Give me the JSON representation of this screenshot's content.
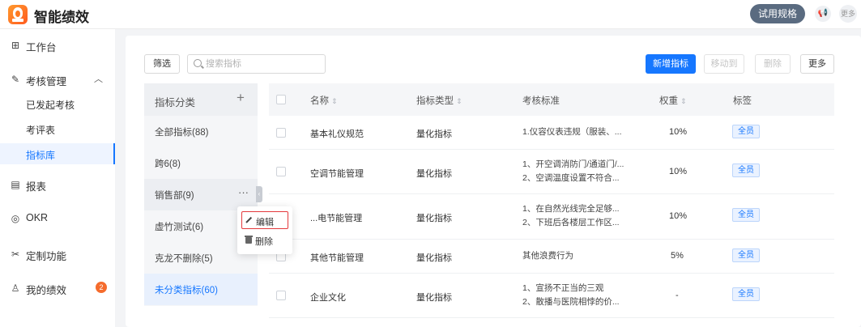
{
  "app": {
    "title": "智能绩效"
  },
  "topbar": {
    "trial_label": "试用规格",
    "more_label": "更多"
  },
  "sidebar": {
    "items": [
      {
        "label": "工作台",
        "icon": "grid-icon"
      },
      {
        "label": "考核管理",
        "icon": "assessment-icon"
      },
      {
        "label": "已发起考核"
      },
      {
        "label": "考评表"
      },
      {
        "label": "指标库"
      },
      {
        "label": "报表",
        "icon": "report-icon"
      },
      {
        "label": "OKR",
        "icon": "target-icon"
      },
      {
        "label": "定制功能",
        "icon": "customize-icon"
      },
      {
        "label": "我的绩效",
        "icon": "user-icon",
        "badge": "2"
      }
    ],
    "active": "指标库"
  },
  "toolbar": {
    "filter_label": "筛选",
    "search_placeholder": "搜索指标",
    "add_label": "新增指标",
    "move_label": "移动到",
    "delete_label": "删除",
    "more_label": "更多"
  },
  "categories": {
    "header": "指标分类",
    "items": [
      {
        "label": "全部指标(88)"
      },
      {
        "label": "跨6(8)"
      },
      {
        "label": "销售部(9)"
      },
      {
        "label": "虚竹测试(6)"
      },
      {
        "label": "克龙不删除(5)"
      },
      {
        "label": "未分类指标(60)"
      }
    ]
  },
  "context_menu": {
    "edit_label": "编辑",
    "delete_label": "删除"
  },
  "table": {
    "headers": {
      "name": "名称",
      "type": "指标类型",
      "standard": "考核标准",
      "weight": "权重",
      "tag": "标签"
    },
    "rows": [
      {
        "name": "基本礼仪规范",
        "type": "量化指标",
        "standard": [
          "1.仪容仪表违规（服装、..."
        ],
        "weight": "10%",
        "tag": "全员"
      },
      {
        "name": "空调节能管理",
        "type": "量化指标",
        "standard": [
          "1、开空调消防门/通道门/...",
          "2、空调温度设置不符合..."
        ],
        "weight": "10%",
        "tag": "全员"
      },
      {
        "name": "...电节能管理",
        "type": "量化指标",
        "standard": [
          "1、在自然光线完全足够...",
          "2、下班后各楼层工作区..."
        ],
        "weight": "10%",
        "tag": "全员"
      },
      {
        "name": "其他节能管理",
        "type": "量化指标",
        "standard": [
          "其他浪费行为"
        ],
        "weight": "5%",
        "tag": "全员"
      },
      {
        "name": "企业文化",
        "type": "量化指标",
        "standard": [
          "1、宣扬不正当的三观",
          "2、散播与医院相悖的价..."
        ],
        "weight": "-",
        "tag": "全员"
      }
    ]
  }
}
